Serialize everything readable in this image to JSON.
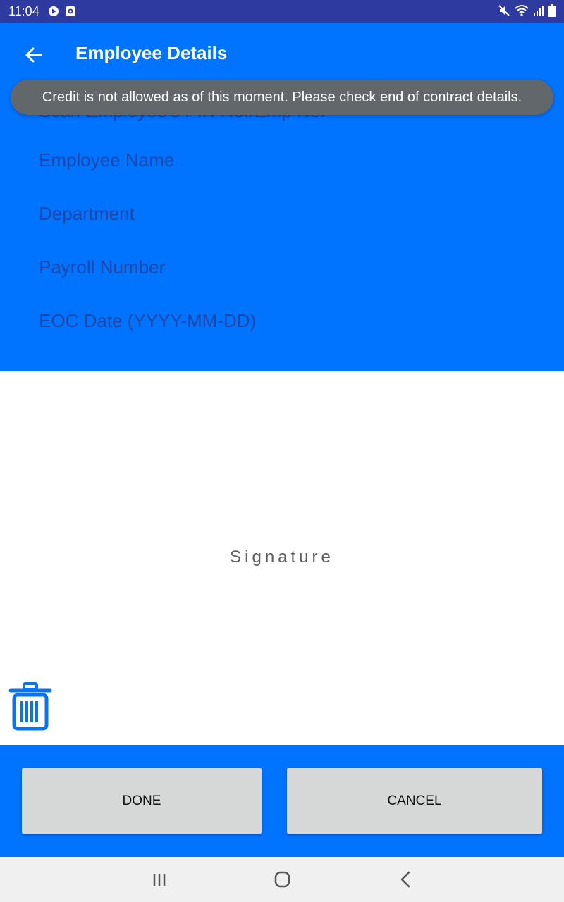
{
  "status_bar": {
    "time": "11:04",
    "left_icons": [
      "media-icon",
      "notification-icon"
    ],
    "right_icons": [
      "mute-icon",
      "wifi-icon",
      "signal-icon",
      "battery-icon"
    ]
  },
  "app_bar": {
    "title": "Employee Details",
    "back_icon": "arrow-left-icon"
  },
  "form": {
    "scan_placeholder": "Scan Employee's PIN No./Emp No.",
    "employee_name_label": "Employee Name",
    "department_label": "Department",
    "payroll_number_label": "Payroll Number",
    "eoc_date_label": "EOC Date (YYYY-MM-DD)"
  },
  "toast": {
    "message": "Credit is not allowed as of this moment. Please check end of contract details."
  },
  "signature": {
    "label": "Signature",
    "clear_icon": "trash-icon"
  },
  "buttons": {
    "done_label": "DONE",
    "cancel_label": "CANCEL"
  },
  "nav_bar": {
    "icons": [
      "recent-apps-icon",
      "home-icon",
      "back-icon"
    ]
  },
  "colors": {
    "status_bar": "#2f3aa1",
    "primary_blue": "#0073ff",
    "field_text": "#1c46a8",
    "toast_bg": "#62676c",
    "button_bg": "#d6d7d7",
    "nav_bar_bg": "#f0f0f0"
  }
}
